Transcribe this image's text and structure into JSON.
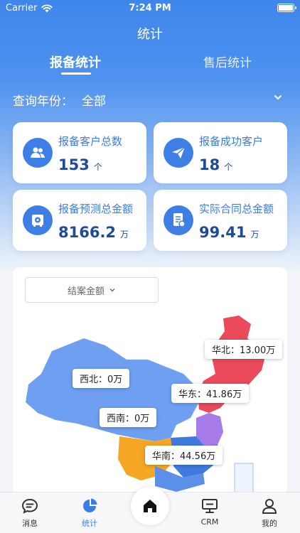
{
  "status_bar": {
    "carrier": "Carrier",
    "time": "7:24 PM"
  },
  "nav": {
    "title": "统计"
  },
  "tabs": [
    {
      "label": "报备统计",
      "active": true
    },
    {
      "label": "售后统计",
      "active": false
    }
  ],
  "filter": {
    "label": "查询年份：",
    "value": "全部",
    "icon": "chevron-down-icon"
  },
  "stats": [
    {
      "title": "报备客户总数",
      "value": "153",
      "unit": "个",
      "icon": "users-icon"
    },
    {
      "title": "报备成功客户",
      "value": "18",
      "unit": "个",
      "icon": "paper-plane-icon"
    },
    {
      "title": "报备预测总金额",
      "value": "8166.2",
      "unit": "万",
      "icon": "safe-icon"
    },
    {
      "title": "实际合同总金额",
      "value": "99.41",
      "unit": "万",
      "icon": "contract-icon"
    }
  ],
  "map": {
    "dropdown_label": "结案金额",
    "tooltips": {
      "huabei": "华北：13.00万",
      "xibei": "西北：0万",
      "huadong": "华东：41.86万",
      "xinan": "西南：0万",
      "huanan": "华南：44.56万"
    },
    "colors": {
      "base": "#6e9ff0",
      "huabei": "#ea4a5a",
      "huadong": "#a77bea",
      "huanan": "#f5a623",
      "light": "#9fc1f5"
    }
  },
  "tabbar": [
    {
      "label": "消息",
      "icon": "message-icon",
      "active": false
    },
    {
      "label": "统计",
      "icon": "pie-chart-icon",
      "active": true
    },
    {
      "label": "",
      "icon": "home-icon",
      "active": false
    },
    {
      "label": "CRM",
      "icon": "monitor-icon",
      "active": false
    },
    {
      "label": "我的",
      "icon": "user-icon",
      "active": false
    }
  ]
}
